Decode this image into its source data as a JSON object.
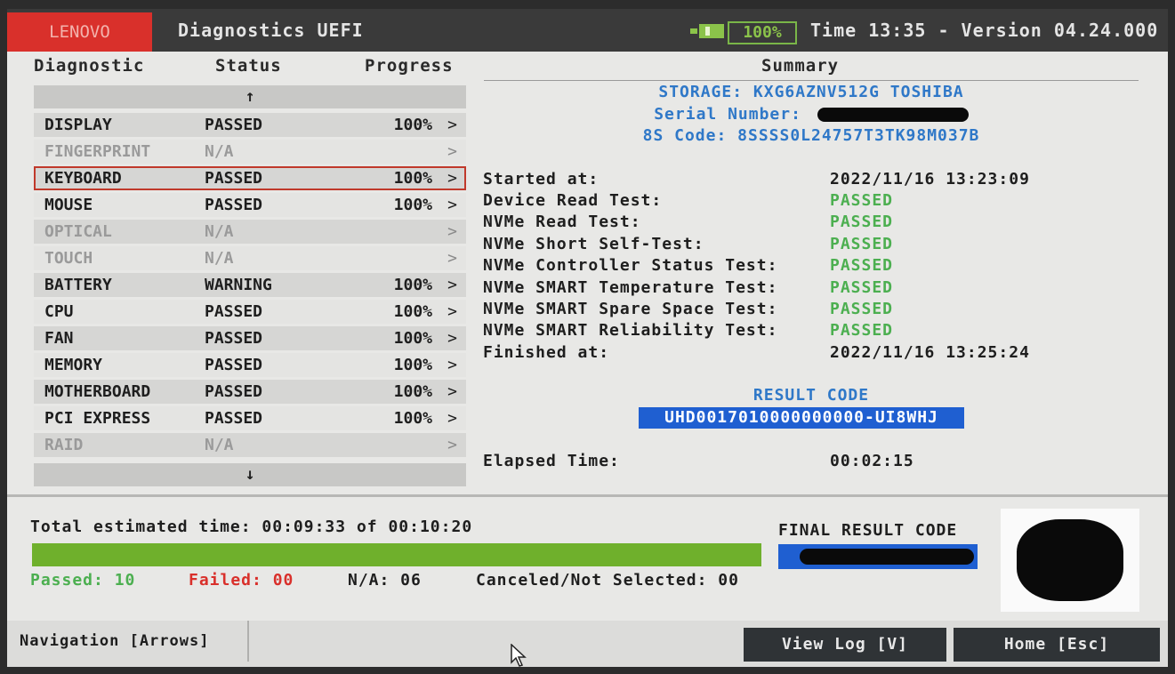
{
  "topbar": {
    "brand": "LENOVO",
    "title": "Diagnostics UEFI",
    "battery_icon": "battery-icon",
    "battery_percent": "100%",
    "time_version": "Time 13:35 - Version 04.24.000"
  },
  "columns": {
    "diagnostic": "Diagnostic",
    "status": "Status",
    "progress": "Progress",
    "summary": "Summary"
  },
  "list": {
    "scroll_up": "↑",
    "scroll_down": "↓",
    "chevron": ">",
    "rows": [
      {
        "name": "DISPLAY",
        "status": "PASSED",
        "progress": "100%"
      },
      {
        "name": "FINGERPRINT",
        "status": "N/A",
        "progress": ""
      },
      {
        "name": "KEYBOARD",
        "status": "PASSED",
        "progress": "100%"
      },
      {
        "name": "MOUSE",
        "status": "PASSED",
        "progress": "100%"
      },
      {
        "name": "OPTICAL",
        "status": "N/A",
        "progress": ""
      },
      {
        "name": "TOUCH",
        "status": "N/A",
        "progress": ""
      },
      {
        "name": "BATTERY",
        "status": "WARNING",
        "progress": "100%"
      },
      {
        "name": "CPU",
        "status": "PASSED",
        "progress": "100%"
      },
      {
        "name": "FAN",
        "status": "PASSED",
        "progress": "100%"
      },
      {
        "name": "MEMORY",
        "status": "PASSED",
        "progress": "100%"
      },
      {
        "name": "MOTHERBOARD",
        "status": "PASSED",
        "progress": "100%"
      },
      {
        "name": "PCI EXPRESS",
        "status": "PASSED",
        "progress": "100%"
      },
      {
        "name": "RAID",
        "status": "N/A",
        "progress": ""
      }
    ]
  },
  "summary": {
    "storage": "STORAGE: KXG6AZNV512G TOSHIBA",
    "serial_label": "Serial Number:",
    "code_8s": "8S Code: 8SSSS0L24757T3TK98M037B",
    "items": [
      {
        "label": "Started at:",
        "value": "2022/11/16 13:23:09"
      },
      {
        "label": "Device Read Test:",
        "value": "PASSED"
      },
      {
        "label": "NVMe Read Test:",
        "value": "PASSED"
      },
      {
        "label": "NVMe Short Self-Test:",
        "value": "PASSED"
      },
      {
        "label": "NVMe Controller Status Test:",
        "value": "PASSED"
      },
      {
        "label": "NVMe SMART Temperature Test:",
        "value": "PASSED"
      },
      {
        "label": "NVMe SMART Spare Space Test:",
        "value": "PASSED"
      },
      {
        "label": "NVMe SMART Reliability Test:",
        "value": "PASSED"
      },
      {
        "label": "Finished at:",
        "value": "2022/11/16 13:25:24"
      }
    ],
    "result_code_label": "RESULT CODE",
    "result_code": "UHD0017010000000000-UI8WHJ",
    "elapsed_label": "Elapsed Time:",
    "elapsed_value": "00:02:15"
  },
  "totals": {
    "estimated": "Total estimated time: 00:09:33 of 00:10:20",
    "progress_fraction": 1.0,
    "passed": "Passed: 10",
    "failed": "Failed: 00",
    "na": "N/A: 06",
    "canceled": "Canceled/Not Selected: 00",
    "final_label": "FINAL RESULT CODE"
  },
  "colors": {
    "brand_red": "#d9302b",
    "pass_green": "#4caf50",
    "fail_red": "#d9302b",
    "accent_blue": "#2f78c8",
    "progress_green": "#6fb02c"
  },
  "footer": {
    "navigation": "Navigation [Arrows]",
    "view_log": "View Log [V]",
    "home": "Home [Esc]"
  }
}
